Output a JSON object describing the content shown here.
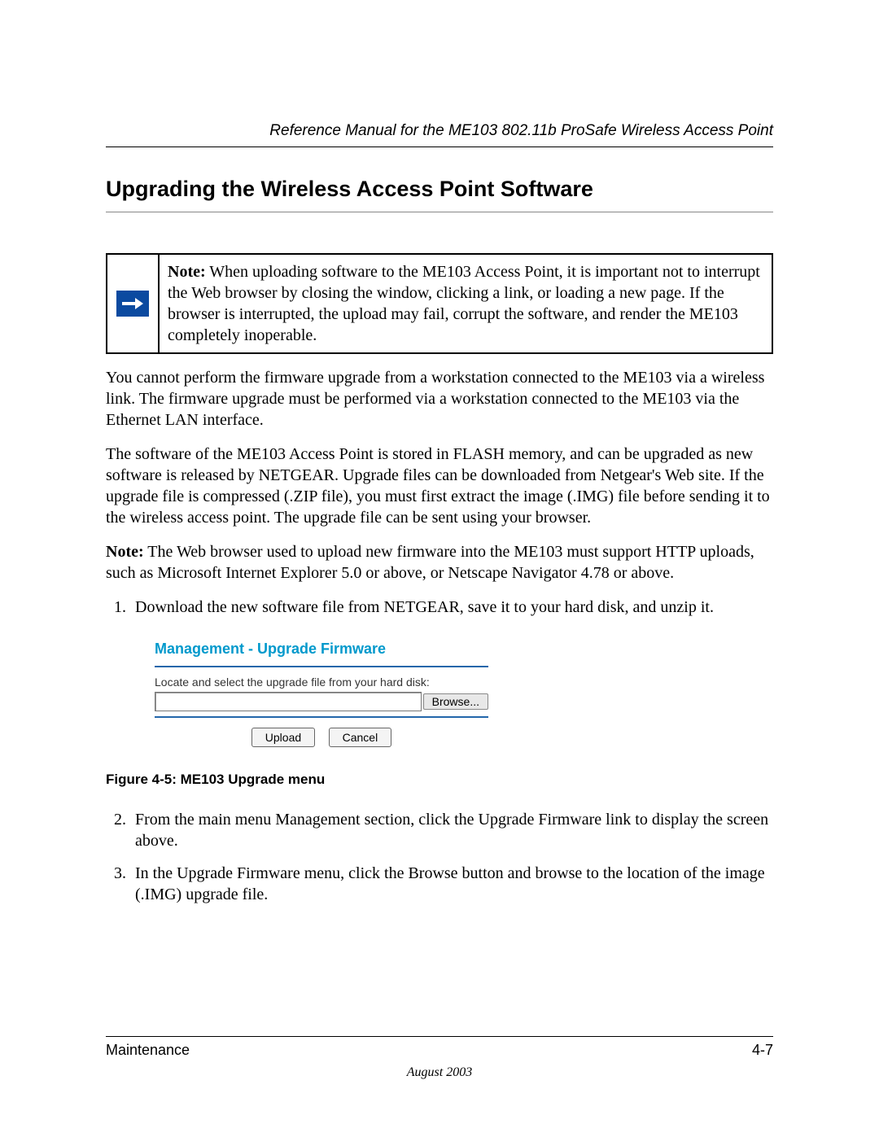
{
  "header": {
    "manual_title": "Reference Manual for the ME103 802.11b ProSafe Wireless Access Point"
  },
  "heading": "Upgrading the Wireless Access Point Software",
  "note": {
    "label": "Note:",
    "text": " When uploading software to the ME103 Access Point, it is important not to interrupt the Web browser by closing the window, clicking a link, or loading a new page. If the browser is interrupted, the upload may fail, corrupt the software, and render the ME103 completely inoperable."
  },
  "paragraphs": {
    "p1": "You cannot perform the firmware upgrade from a workstation connected to the ME103 via a wireless link. The firmware upgrade must be performed via a workstation connected to the ME103 via the Ethernet LAN interface.",
    "p2": "The software of the ME103 Access Point is stored in FLASH memory, and can be upgraded as new software is released by NETGEAR. Upgrade files can be downloaded from Netgear's Web site. If the upgrade file is compressed (.ZIP file), you must first extract the image (.IMG) file before sending it to the wireless access point. The upgrade file can be sent using your browser.",
    "p3_label": "Note:",
    "p3_text": " The Web browser used to upload new firmware into the ME103 must support HTTP uploads, such as Microsoft Internet Explorer 5.0 or above, or Netscape Navigator 4.78 or above."
  },
  "steps": {
    "s1": "Download the new software file from NETGEAR, save it to your hard disk, and unzip it.",
    "s2": "From the main menu Management section, click the Upgrade Firmware link to display the screen above.",
    "s3": "In the Upgrade Firmware menu, click the Browse button and browse to the location of the image (.IMG) upgrade file."
  },
  "firmware": {
    "title": "Management - Upgrade Firmware",
    "instruction": "Locate and select the upgrade file from your hard disk:",
    "browse": "Browse...",
    "upload": "Upload",
    "cancel": "Cancel"
  },
  "figure_caption": "Figure 4-5:  ME103 Upgrade menu",
  "footer": {
    "section": "Maintenance",
    "page_num": "4-7",
    "date": "August 2003"
  }
}
